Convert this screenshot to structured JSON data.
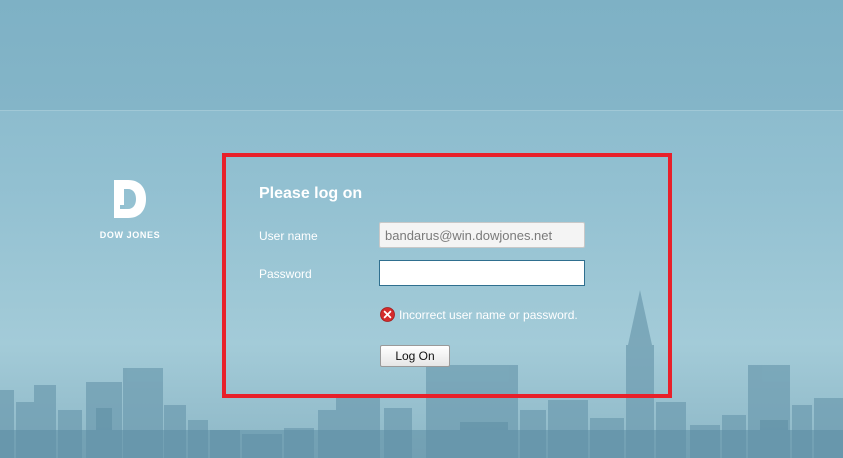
{
  "brand": {
    "logo_text": "DOW JONES"
  },
  "login": {
    "title": "Please log on",
    "username_label": "User name",
    "username_value": "bandarus@win.dowjones.net",
    "password_label": "Password",
    "password_value": "",
    "error_message": "Incorrect user name or password.",
    "logon_label": "Log On"
  },
  "icons": {
    "logo": "dow-jones-d-logo-icon",
    "error": "error-x-icon"
  },
  "colors": {
    "highlight_border": "#e8202a",
    "error_icon": "#d42b2b",
    "background": "#92c0d1"
  }
}
